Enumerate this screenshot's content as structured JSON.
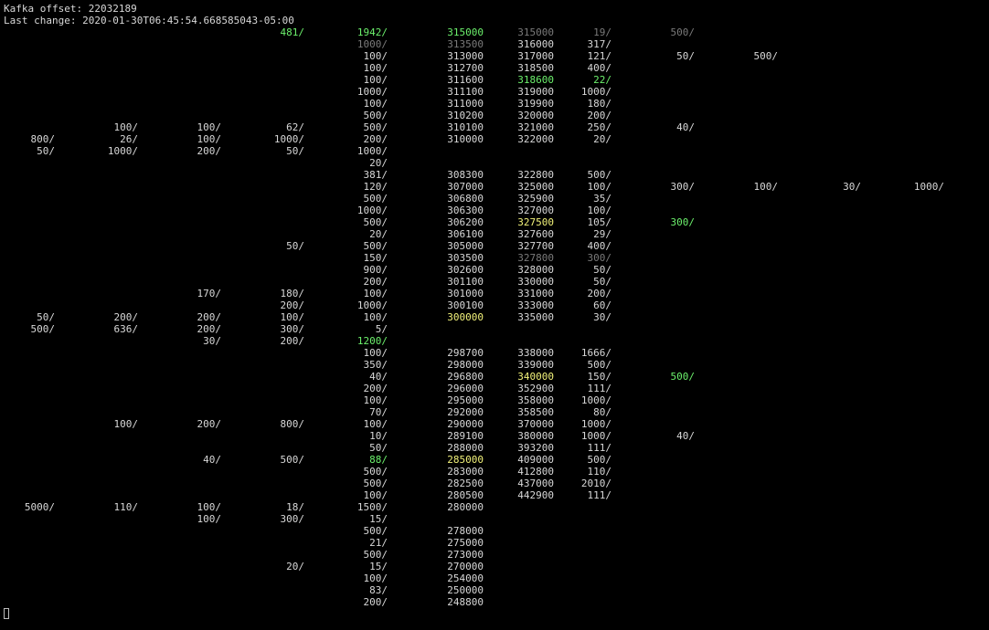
{
  "header": {
    "offset_line": "Kafka offset: 22032189",
    "last_change_line": "Last change: 2020-01-30T06:45:54.668585043-05:00"
  },
  "colors": {
    "background": "#000000",
    "text": "#d8d8d8",
    "dim": "#7a7a7a",
    "green": "#6cf06c",
    "yellow": "#f2f27a"
  },
  "rows": [
    [
      [
        3,
        "481/",
        "g"
      ],
      [
        4,
        "1942/",
        "g"
      ],
      [
        5,
        "315000",
        "g"
      ],
      [
        6,
        "315000",
        "d"
      ],
      [
        7,
        "19/",
        "d"
      ],
      [
        8,
        "500/",
        "d"
      ]
    ],
    [
      [
        4,
        "1000/",
        "d"
      ],
      [
        5,
        "313500",
        "d"
      ],
      [
        6,
        "316000",
        ""
      ],
      [
        7,
        "317/",
        ""
      ]
    ],
    [
      [
        4,
        "100/",
        ""
      ],
      [
        5,
        "313000",
        ""
      ],
      [
        6,
        "317000",
        ""
      ],
      [
        7,
        "121/",
        ""
      ],
      [
        8,
        "50/",
        ""
      ],
      [
        9,
        "500/",
        ""
      ]
    ],
    [
      [
        4,
        "100/",
        ""
      ],
      [
        5,
        "312700",
        ""
      ],
      [
        6,
        "318500",
        ""
      ],
      [
        7,
        "400/",
        ""
      ]
    ],
    [
      [
        4,
        "100/",
        ""
      ],
      [
        5,
        "311600",
        ""
      ],
      [
        6,
        "318600",
        "g"
      ],
      [
        7,
        "22/",
        "g"
      ]
    ],
    [
      [
        4,
        "1000/",
        ""
      ],
      [
        5,
        "311100",
        ""
      ],
      [
        6,
        "319000",
        ""
      ],
      [
        7,
        "1000/",
        ""
      ]
    ],
    [
      [
        4,
        "100/",
        ""
      ],
      [
        5,
        "311000",
        ""
      ],
      [
        6,
        "319900",
        ""
      ],
      [
        7,
        "180/",
        ""
      ]
    ],
    [
      [
        4,
        "500/",
        ""
      ],
      [
        5,
        "310200",
        ""
      ],
      [
        6,
        "320000",
        ""
      ],
      [
        7,
        "200/",
        ""
      ]
    ],
    [
      [
        1,
        "100/",
        ""
      ],
      [
        2,
        "100/",
        ""
      ],
      [
        3,
        "62/",
        ""
      ],
      [
        4,
        "500/",
        ""
      ],
      [
        5,
        "310100",
        ""
      ],
      [
        6,
        "321000",
        ""
      ],
      [
        7,
        "250/",
        ""
      ],
      [
        8,
        "40/",
        ""
      ]
    ],
    [
      [
        0,
        "800/",
        ""
      ],
      [
        1,
        "26/",
        ""
      ],
      [
        2,
        "100/",
        ""
      ],
      [
        3,
        "1000/",
        ""
      ],
      [
        4,
        "200/",
        ""
      ],
      [
        5,
        "310000",
        ""
      ],
      [
        6,
        "322000",
        ""
      ],
      [
        7,
        "20/",
        ""
      ]
    ],
    [
      [
        0,
        "50/",
        ""
      ],
      [
        1,
        "1000/",
        ""
      ],
      [
        2,
        "200/",
        ""
      ],
      [
        3,
        "50/",
        ""
      ],
      [
        4,
        "1000/",
        ""
      ]
    ],
    [
      [
        4,
        "20/",
        ""
      ]
    ],
    [
      [
        4,
        "381/",
        ""
      ],
      [
        5,
        "308300",
        ""
      ],
      [
        6,
        "322800",
        ""
      ],
      [
        7,
        "500/",
        ""
      ]
    ],
    [
      [
        4,
        "120/",
        ""
      ],
      [
        5,
        "307000",
        ""
      ],
      [
        6,
        "325000",
        ""
      ],
      [
        7,
        "100/",
        ""
      ],
      [
        8,
        "300/",
        ""
      ],
      [
        9,
        "100/",
        ""
      ],
      [
        10,
        "30/",
        ""
      ],
      [
        11,
        "1000/",
        ""
      ]
    ],
    [
      [
        4,
        "500/",
        ""
      ],
      [
        5,
        "306800",
        ""
      ],
      [
        6,
        "325900",
        ""
      ],
      [
        7,
        "35/",
        ""
      ]
    ],
    [
      [
        4,
        "1000/",
        ""
      ],
      [
        5,
        "306300",
        ""
      ],
      [
        6,
        "327000",
        ""
      ],
      [
        7,
        "100/",
        ""
      ]
    ],
    [
      [
        4,
        "500/",
        ""
      ],
      [
        5,
        "306200",
        ""
      ],
      [
        6,
        "327500",
        "y"
      ],
      [
        7,
        "105/",
        ""
      ],
      [
        8,
        "300/",
        "g"
      ]
    ],
    [
      [
        4,
        "20/",
        ""
      ],
      [
        5,
        "306100",
        ""
      ],
      [
        6,
        "327600",
        ""
      ],
      [
        7,
        "29/",
        ""
      ]
    ],
    [
      [
        3,
        "50/",
        ""
      ],
      [
        4,
        "500/",
        ""
      ],
      [
        5,
        "305000",
        ""
      ],
      [
        6,
        "327700",
        ""
      ],
      [
        7,
        "400/",
        ""
      ]
    ],
    [
      [
        4,
        "150/",
        ""
      ],
      [
        5,
        "303500",
        ""
      ],
      [
        6,
        "327800",
        "d"
      ],
      [
        7,
        "300/",
        "d"
      ]
    ],
    [
      [
        4,
        "900/",
        ""
      ],
      [
        5,
        "302600",
        ""
      ],
      [
        6,
        "328000",
        ""
      ],
      [
        7,
        "50/",
        ""
      ]
    ],
    [
      [
        4,
        "200/",
        ""
      ],
      [
        5,
        "301100",
        ""
      ],
      [
        6,
        "330000",
        ""
      ],
      [
        7,
        "50/",
        ""
      ]
    ],
    [
      [
        2,
        "170/",
        ""
      ],
      [
        3,
        "180/",
        ""
      ],
      [
        4,
        "100/",
        ""
      ],
      [
        5,
        "301000",
        ""
      ],
      [
        6,
        "331000",
        ""
      ],
      [
        7,
        "200/",
        ""
      ]
    ],
    [
      [
        3,
        "200/",
        ""
      ],
      [
        4,
        "1000/",
        ""
      ],
      [
        5,
        "300100",
        ""
      ],
      [
        6,
        "333000",
        ""
      ],
      [
        7,
        "60/",
        ""
      ]
    ],
    [
      [
        0,
        "50/",
        ""
      ],
      [
        1,
        "200/",
        ""
      ],
      [
        2,
        "200/",
        ""
      ],
      [
        3,
        "100/",
        ""
      ],
      [
        4,
        "100/",
        ""
      ],
      [
        5,
        "300000",
        "y"
      ],
      [
        6,
        "335000",
        ""
      ],
      [
        7,
        "30/",
        ""
      ]
    ],
    [
      [
        0,
        "500/",
        ""
      ],
      [
        1,
        "636/",
        ""
      ],
      [
        2,
        "200/",
        ""
      ],
      [
        3,
        "300/",
        ""
      ],
      [
        4,
        "5/",
        ""
      ]
    ],
    [
      [
        2,
        "30/",
        ""
      ],
      [
        3,
        "200/",
        ""
      ],
      [
        4,
        "1200/",
        "g"
      ]
    ],
    [
      [
        4,
        "100/",
        ""
      ],
      [
        5,
        "298700",
        ""
      ],
      [
        6,
        "338000",
        ""
      ],
      [
        7,
        "1666/",
        ""
      ]
    ],
    [
      [
        4,
        "350/",
        ""
      ],
      [
        5,
        "298000",
        ""
      ],
      [
        6,
        "339000",
        ""
      ],
      [
        7,
        "500/",
        ""
      ]
    ],
    [
      [
        4,
        "40/",
        ""
      ],
      [
        5,
        "296800",
        ""
      ],
      [
        6,
        "340000",
        "y"
      ],
      [
        7,
        "150/",
        ""
      ],
      [
        8,
        "500/",
        "g"
      ]
    ],
    [
      [
        4,
        "200/",
        ""
      ],
      [
        5,
        "296000",
        ""
      ],
      [
        6,
        "352900",
        ""
      ],
      [
        7,
        "111/",
        ""
      ]
    ],
    [
      [
        4,
        "100/",
        ""
      ],
      [
        5,
        "295000",
        ""
      ],
      [
        6,
        "358000",
        ""
      ],
      [
        7,
        "1000/",
        ""
      ]
    ],
    [
      [
        4,
        "70/",
        ""
      ],
      [
        5,
        "292000",
        ""
      ],
      [
        6,
        "358500",
        ""
      ],
      [
        7,
        "80/",
        ""
      ]
    ],
    [
      [
        1,
        "100/",
        ""
      ],
      [
        2,
        "200/",
        ""
      ],
      [
        3,
        "800/",
        ""
      ],
      [
        4,
        "100/",
        ""
      ],
      [
        5,
        "290000",
        ""
      ],
      [
        6,
        "370000",
        ""
      ],
      [
        7,
        "1000/",
        ""
      ]
    ],
    [
      [
        4,
        "10/",
        ""
      ],
      [
        5,
        "289100",
        ""
      ],
      [
        6,
        "380000",
        ""
      ],
      [
        7,
        "1000/",
        ""
      ],
      [
        8,
        "40/",
        ""
      ]
    ],
    [
      [
        4,
        "50/",
        ""
      ],
      [
        5,
        "288000",
        ""
      ],
      [
        6,
        "393200",
        ""
      ],
      [
        7,
        "111/",
        ""
      ]
    ],
    [
      [
        2,
        "40/",
        ""
      ],
      [
        3,
        "500/",
        ""
      ],
      [
        4,
        "88/",
        "g"
      ],
      [
        5,
        "285000",
        "y"
      ],
      [
        6,
        "409000",
        ""
      ],
      [
        7,
        "500/",
        ""
      ]
    ],
    [
      [
        4,
        "500/",
        ""
      ],
      [
        5,
        "283000",
        ""
      ],
      [
        6,
        "412800",
        ""
      ],
      [
        7,
        "110/",
        ""
      ]
    ],
    [
      [
        4,
        "500/",
        ""
      ],
      [
        5,
        "282500",
        ""
      ],
      [
        6,
        "437000",
        ""
      ],
      [
        7,
        "2010/",
        ""
      ]
    ],
    [
      [
        4,
        "100/",
        ""
      ],
      [
        5,
        "280500",
        ""
      ],
      [
        6,
        "442900",
        ""
      ],
      [
        7,
        "111/",
        ""
      ]
    ],
    [
      [
        0,
        "5000/",
        ""
      ],
      [
        1,
        "110/",
        ""
      ],
      [
        2,
        "100/",
        ""
      ],
      [
        3,
        "18/",
        ""
      ],
      [
        4,
        "1500/",
        ""
      ],
      [
        5,
        "280000",
        ""
      ]
    ],
    [
      [
        2,
        "100/",
        ""
      ],
      [
        3,
        "300/",
        ""
      ],
      [
        4,
        "15/",
        ""
      ]
    ],
    [
      [
        4,
        "500/",
        ""
      ],
      [
        5,
        "278000",
        ""
      ]
    ],
    [
      [
        4,
        "21/",
        ""
      ],
      [
        5,
        "275000",
        ""
      ]
    ],
    [
      [
        4,
        "500/",
        ""
      ],
      [
        5,
        "273000",
        ""
      ]
    ],
    [
      [
        3,
        "20/",
        ""
      ],
      [
        4,
        "15/",
        ""
      ],
      [
        5,
        "270000",
        ""
      ]
    ],
    [
      [
        4,
        "100/",
        ""
      ],
      [
        5,
        "254000",
        ""
      ]
    ],
    [
      [
        4,
        "83/",
        ""
      ],
      [
        5,
        "250000",
        ""
      ]
    ],
    [
      [
        4,
        "200/",
        ""
      ],
      [
        5,
        "248800",
        ""
      ]
    ]
  ]
}
